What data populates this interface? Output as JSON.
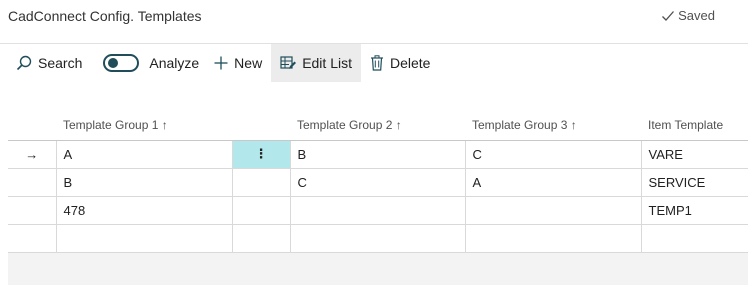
{
  "header": {
    "title": "CadConnect Config. Templates",
    "saved_label": "Saved"
  },
  "toolbar": {
    "search_label": "Search",
    "analyze_label": "Analyze",
    "new_label": "New",
    "edit_list_label": "Edit List",
    "delete_label": "Delete"
  },
  "grid": {
    "columns": [
      "Template Group 1 ↑",
      "Template Group 2 ↑",
      "Template Group 3 ↑",
      "Item Template"
    ],
    "rows": [
      {
        "indicator": "→",
        "g1": "A",
        "g2": "B",
        "g3": "C",
        "item": "VARE"
      },
      {
        "indicator": "",
        "g1": "B",
        "g2": "C",
        "g3": "A",
        "item": "SERVICE"
      },
      {
        "indicator": "",
        "g1": "478",
        "g2": "",
        "g3": "",
        "item": "TEMP1"
      },
      {
        "indicator": "",
        "g1": "",
        "g2": "",
        "g3": "",
        "item": ""
      }
    ],
    "row_menu_glyph": "⋮"
  },
  "colors": {
    "accent": "#1f4d5a",
    "selected_cell": "#b2e8ec",
    "active_action_bg": "#ececec"
  },
  "icons": {
    "search": "search-icon",
    "new": "plus-icon",
    "edit_list": "edit-list-icon",
    "delete": "trash-icon",
    "saved": "checkmark-icon",
    "row_indicator": "arrow-right-icon"
  }
}
